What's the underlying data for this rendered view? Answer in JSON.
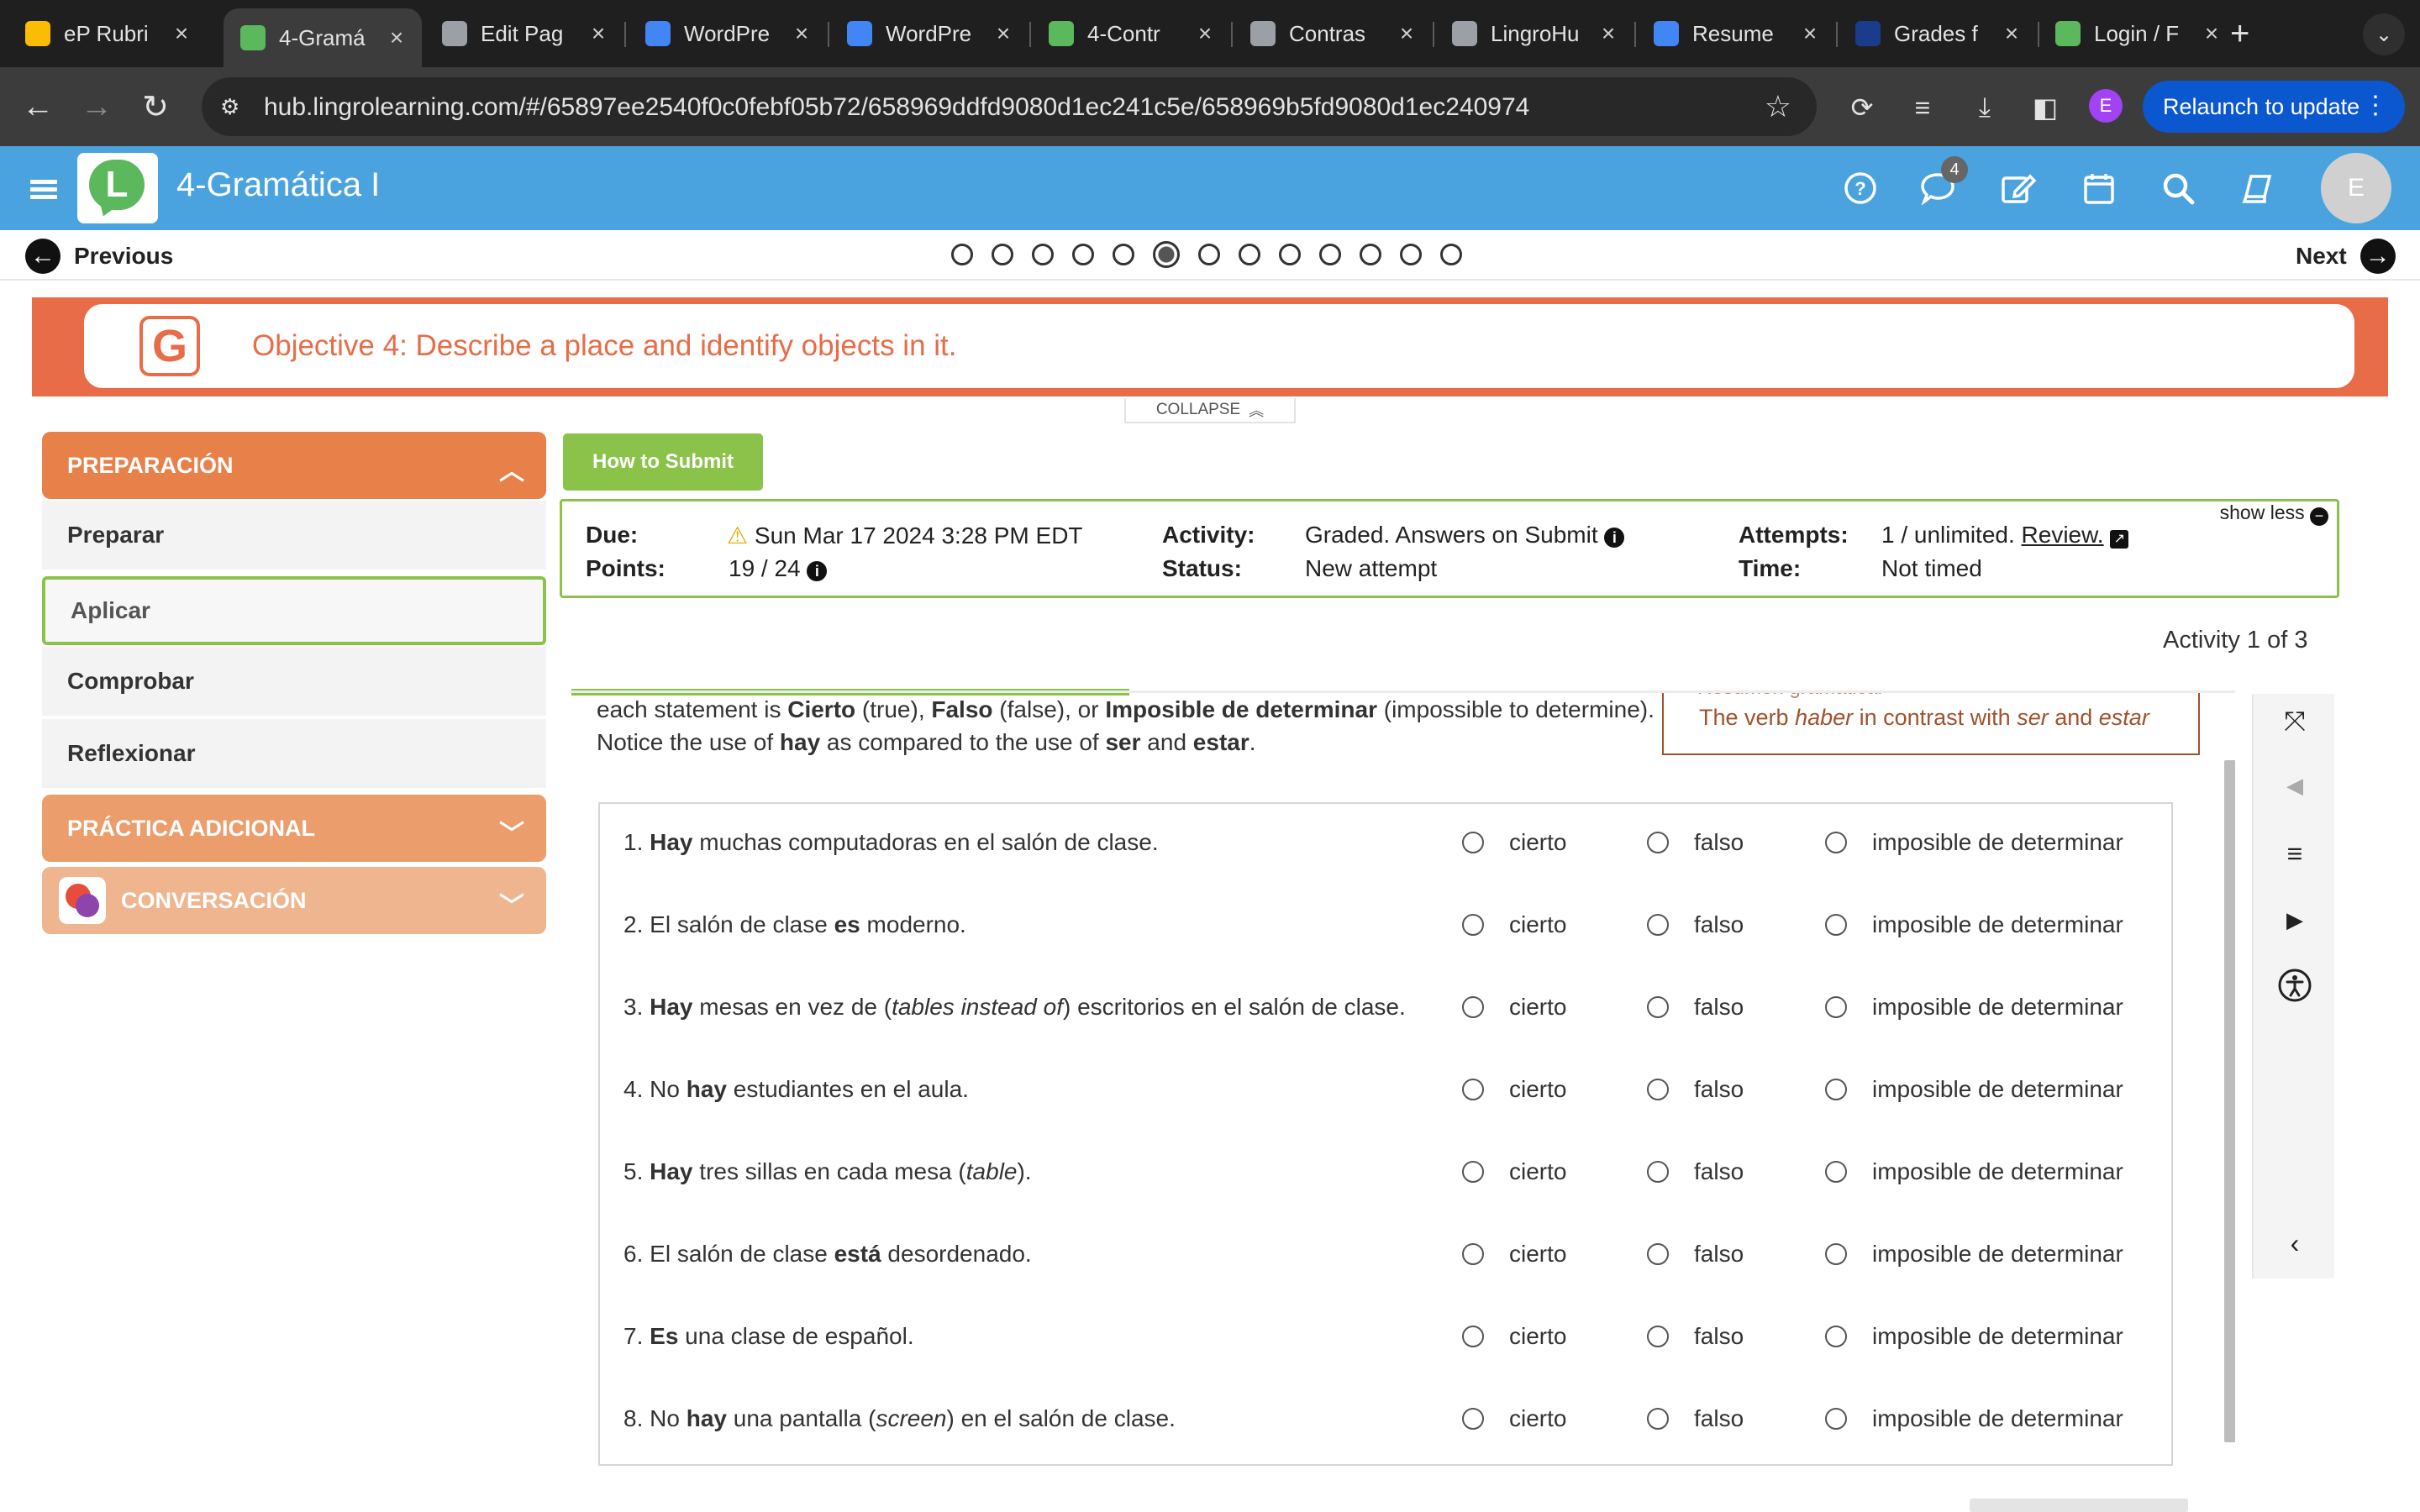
{
  "browser": {
    "tabs": [
      {
        "title": "eP Rubri",
        "icon": "google-drive-icon",
        "color": "#fbbc04"
      },
      {
        "title": "4-Gramá",
        "icon": "lingro-icon",
        "color": "#5cb85c",
        "active": true
      },
      {
        "title": "Edit Pag",
        "icon": "globe-icon",
        "color": "#9aa0a6"
      },
      {
        "title": "WordPre",
        "icon": "docs-icon",
        "color": "#4285f4"
      },
      {
        "title": "WordPre",
        "icon": "docs-icon",
        "color": "#4285f4"
      },
      {
        "title": "4-Contr",
        "icon": "lingro-icon",
        "color": "#5cb85c"
      },
      {
        "title": "Contras",
        "icon": "globe-icon",
        "color": "#9aa0a6"
      },
      {
        "title": "LingroHu",
        "icon": "globe-icon",
        "color": "#9aa0a6"
      },
      {
        "title": "Resume",
        "icon": "docs-icon",
        "color": "#4285f4"
      },
      {
        "title": "Grades f",
        "icon": "grades-icon",
        "color": "#1a3c8a"
      },
      {
        "title": "Login / F",
        "icon": "lingro-icon",
        "color": "#5cb85c"
      }
    ],
    "url": "hub.lingrolearning.com/#/65897ee2540f0c0febf05b72/658969ddfd9080d1ec241c5e/658969b5fd9080d1ec240974",
    "profile_initial": "E",
    "relaunch_label": "Relaunch to update"
  },
  "app": {
    "title": "4-Gramática I",
    "logo_letter": "L",
    "chat_badge": "4",
    "avatar_initial": "E"
  },
  "pager": {
    "previous": "Previous",
    "next": "Next",
    "total_pages": 13,
    "current_page": 6
  },
  "objective": {
    "icon_letter": "G",
    "text": "Objective 4: Describe a place and identify objects in it."
  },
  "collapse_label": "COLLAPSE",
  "sidebar": {
    "sections": [
      {
        "label": "PREPARACIÓN",
        "color": "#e8804a",
        "expanded": true
      },
      {
        "label": "PRÁCTICA ADICIONAL",
        "color": "#eb9d6b",
        "expanded": false
      },
      {
        "label": "CONVERSACIÓN",
        "color": "#eeb58f",
        "expanded": false
      }
    ],
    "items": [
      "Preparar",
      "Aplicar",
      "Comprobar",
      "Reflexionar"
    ],
    "selected_item": "Aplicar"
  },
  "submit": {
    "how_to_label": "How to Submit",
    "due_label": "Due:",
    "due_value": "Sun Mar 17 2024 3:28 PM EDT",
    "points_label": "Points:",
    "points_value": "19 / 24",
    "activity_label": "Activity:",
    "activity_value": "Graded. Answers on Submit",
    "status_label": "Status:",
    "status_value": "New attempt",
    "attempts_label": "Attempts:",
    "attempts_value": "1 / unlimited.",
    "review_label": "Review.",
    "time_label": "Time:",
    "time_value": "Not timed",
    "show_less": "show less",
    "activity_count": "Activity 1 of 3"
  },
  "instructions": {
    "line1_parts": [
      "each statement is ",
      "Cierto",
      " (true), ",
      "Falso",
      " (false), or ",
      "Imposible de determinar",
      " (impossible to determine)."
    ],
    "line2_parts": [
      "Notice the use of ",
      "hay",
      " as compared to the use of ",
      "ser",
      " and ",
      "estar",
      "."
    ]
  },
  "grammar_box": {
    "peek": "Resumen gramatical",
    "text_parts": [
      "The verb ",
      "haber",
      " in contrast with ",
      "ser",
      " and ",
      "estar"
    ]
  },
  "options": [
    "cierto",
    "falso",
    "imposible de determinar"
  ],
  "questions": [
    {
      "num": "1.",
      "parts": [
        [
          "b",
          "Hay"
        ],
        [
          "n",
          " muchas computadoras en el salón de clase."
        ]
      ]
    },
    {
      "num": "2.",
      "parts": [
        [
          "n",
          "El salón de clase "
        ],
        [
          "b",
          "es"
        ],
        [
          "n",
          " moderno."
        ]
      ]
    },
    {
      "num": "3.",
      "parts": [
        [
          "b",
          "Hay"
        ],
        [
          "n",
          " mesas en vez de ("
        ],
        [
          "i",
          "tables instead of"
        ],
        [
          "n",
          ") escritorios en el salón de clase."
        ]
      ]
    },
    {
      "num": "4.",
      "parts": [
        [
          "n",
          "No "
        ],
        [
          "b",
          "hay"
        ],
        [
          "n",
          " estudiantes en el aula."
        ]
      ]
    },
    {
      "num": "5.",
      "parts": [
        [
          "b",
          "Hay"
        ],
        [
          "n",
          " tres sillas en cada mesa ("
        ],
        [
          "i",
          "table"
        ],
        [
          "n",
          ")."
        ]
      ]
    },
    {
      "num": "6.",
      "parts": [
        [
          "n",
          "El salón de clase "
        ],
        [
          "b",
          "está"
        ],
        [
          "n",
          " desordenado."
        ]
      ]
    },
    {
      "num": "7.",
      "parts": [
        [
          "b",
          "Es"
        ],
        [
          "n",
          " una clase de español."
        ]
      ]
    },
    {
      "num": "8.",
      "parts": [
        [
          "n",
          "No "
        ],
        [
          "b",
          "hay"
        ],
        [
          "n",
          " una pantalla ("
        ],
        [
          "i",
          "screen"
        ],
        [
          "n",
          ") en el salón de clase."
        ]
      ]
    }
  ]
}
